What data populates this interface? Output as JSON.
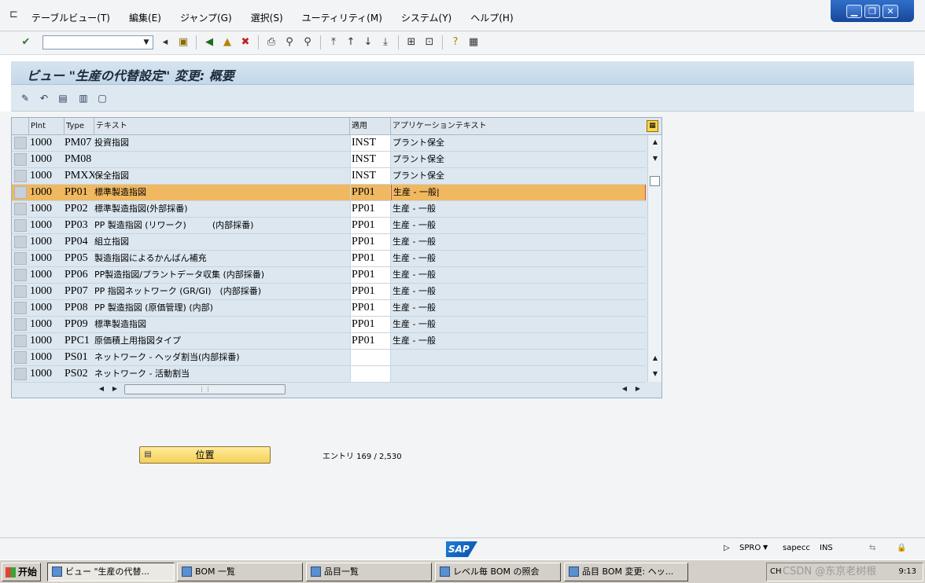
{
  "menu": {
    "items": [
      "テーブルビュー(T)",
      "編集(E)",
      "ジャンプ(G)",
      "選択(S)",
      "ユーティリティ(M)",
      "システム(Y)",
      "ヘルプ(H)"
    ]
  },
  "window_controls": {
    "minimize": "▁",
    "restore": "❐",
    "close": "✕"
  },
  "title": "ビュー \"生産の代替設定\" 変更: 概要",
  "table": {
    "headers": {
      "plant": "Plnt",
      "type": "Type",
      "text": "テキスト",
      "application": "適用",
      "app_text": "アプリケーションテキスト"
    },
    "rows": [
      {
        "plant": "1000",
        "type": "PM07",
        "text": "投資指図",
        "application": "INST",
        "app_text": "プラント保全"
      },
      {
        "plant": "1000",
        "type": "PM08",
        "text": "",
        "application": "INST",
        "app_text": "プラント保全"
      },
      {
        "plant": "1000",
        "type": "PMXX",
        "text": "保全指図",
        "application": "INST",
        "app_text": "プラント保全"
      },
      {
        "plant": "1000",
        "type": "PP01",
        "text": "標準製造指図",
        "application": "PP01",
        "app_text": "生産 - 一般|"
      },
      {
        "plant": "1000",
        "type": "PP02",
        "text": "標準製造指図(外部採番)",
        "application": "PP01",
        "app_text": "生産 - 一般"
      },
      {
        "plant": "1000",
        "type": "PP03",
        "text": "PP 製造指図 (リワーク)　　　(内部採番)",
        "application": "PP01",
        "app_text": "生産 - 一般"
      },
      {
        "plant": "1000",
        "type": "PP04",
        "text": "組立指図",
        "application": "PP01",
        "app_text": "生産 - 一般"
      },
      {
        "plant": "1000",
        "type": "PP05",
        "text": "製造指図によるかんばん補充",
        "application": "PP01",
        "app_text": "生産 - 一般"
      },
      {
        "plant": "1000",
        "type": "PP06",
        "text": "PP製造指図/プラントデータ収集 (内部採番)",
        "application": "PP01",
        "app_text": "生産 - 一般"
      },
      {
        "plant": "1000",
        "type": "PP07",
        "text": "PP 指図ネットワーク (GR/GI)　(内部採番)",
        "application": "PP01",
        "app_text": "生産 - 一般"
      },
      {
        "plant": "1000",
        "type": "PP08",
        "text": "PP 製造指図 (原価管理) (内部)",
        "application": "PP01",
        "app_text": "生産 - 一般"
      },
      {
        "plant": "1000",
        "type": "PP09",
        "text": "標準製造指図",
        "application": "PP01",
        "app_text": "生産 - 一般"
      },
      {
        "plant": "1000",
        "type": "PPC1",
        "text": "原価積上用指図タイプ",
        "application": "PP01",
        "app_text": "生産 - 一般"
      },
      {
        "plant": "1000",
        "type": "PS01",
        "text": "ネットワーク - ヘッダ割当(内部採番)",
        "application": "",
        "app_text": ""
      },
      {
        "plant": "1000",
        "type": "PS02",
        "text": "ネットワーク - 活動割当",
        "application": "",
        "app_text": ""
      }
    ],
    "selected_row_index": 3
  },
  "position_button": {
    "label": "位置"
  },
  "entry_info": "エントリ 169 / 2,530",
  "status_bar": {
    "logo": "SAP",
    "transaction": "SPRO",
    "system": "sapecc",
    "mode": "INS"
  },
  "taskbar": {
    "start_label": "开始",
    "tasks": [
      {
        "label": "ビュー \"生産の代替...",
        "active": true
      },
      {
        "label": "BOM 一覧",
        "active": false
      },
      {
        "label": "品目一覧",
        "active": false
      },
      {
        "label": "レベル毎 BOM の照会",
        "active": false
      },
      {
        "label": "品目 BOM 変更: ヘッ...",
        "active": false
      }
    ],
    "tray_lang": "CH",
    "tray_watermark": "CSDN @东京老树根",
    "clock": "9:13"
  }
}
